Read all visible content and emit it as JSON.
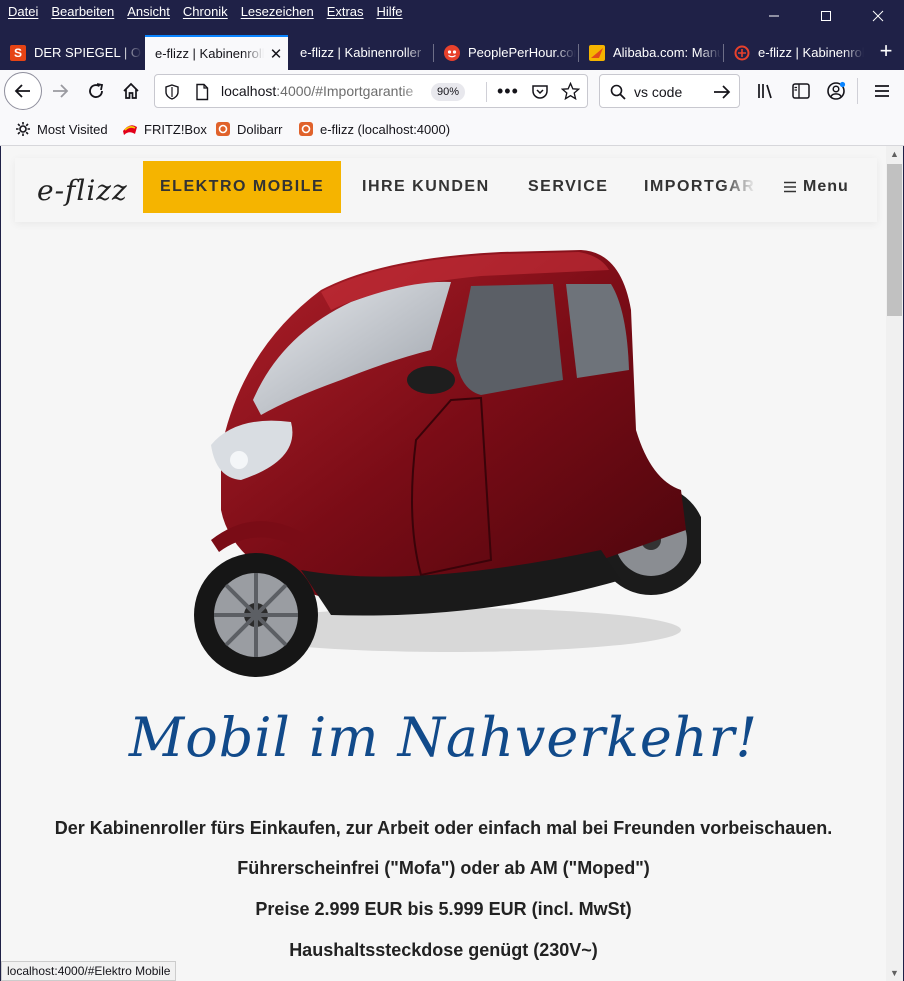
{
  "menubar": {
    "items": [
      "Datei",
      "Bearbeiten",
      "Ansicht",
      "Chronik",
      "Lesezeichen",
      "Extras",
      "Hilfe"
    ]
  },
  "tabs": [
    {
      "label": "DER SPIEGEL | Online",
      "icon": "spiegel-icon",
      "active": false
    },
    {
      "label": "e-flizz | Kabinenroller",
      "icon": "none",
      "active": true
    },
    {
      "label": "e-flizz | Kabinenroller",
      "icon": "none",
      "active": false
    },
    {
      "label": "PeoplePerHour.com",
      "icon": "peopleperhour-icon",
      "active": false
    },
    {
      "label": "Alibaba.com: Manufacturers",
      "icon": "alibaba-icon",
      "active": false
    },
    {
      "label": "e-flizz | Kabinenroller",
      "icon": "e-flizz-icon",
      "active": false
    }
  ],
  "navbar": {
    "url_host": "localhost",
    "url_rest": ":4000/#Importgarantie",
    "zoom": "90%",
    "search_value": "vs code"
  },
  "bookmarks": [
    {
      "label": "Most Visited",
      "icon": "gear-icon"
    },
    {
      "label": "FRITZ!Box",
      "icon": "fritzbox-icon"
    },
    {
      "label": "Dolibarr",
      "icon": "dolibarr-icon"
    },
    {
      "label": "e-flizz (localhost:4000)",
      "icon": "dolibarr-icon"
    }
  ],
  "site": {
    "logo": "e-flizz",
    "nav": {
      "elektro": "ELEKTRO MOBILE",
      "kunden": "IHRE KUNDEN",
      "service": "SERVICE",
      "import": "IMPORTGARANTIE",
      "menu": "Menu"
    },
    "headline": "Mobil im Nahverkehr!",
    "paragraphs": [
      "Der Kabinenroller fürs Einkaufen, zur Arbeit oder einfach mal bei Freunden vorbeischauen.",
      "Führerscheinfrei (\"Mofa\") oder ab AM (\"Moped\")",
      "Preise 2.999 EUR bis 5.999 EUR (incl. MwSt)",
      "Haushaltssteckdose genügt (230V~)"
    ],
    "accent_color": "#f5b400",
    "headline_color": "#114a8a"
  },
  "statusbar": {
    "text": "localhost:4000/#Elektro Mobile"
  }
}
